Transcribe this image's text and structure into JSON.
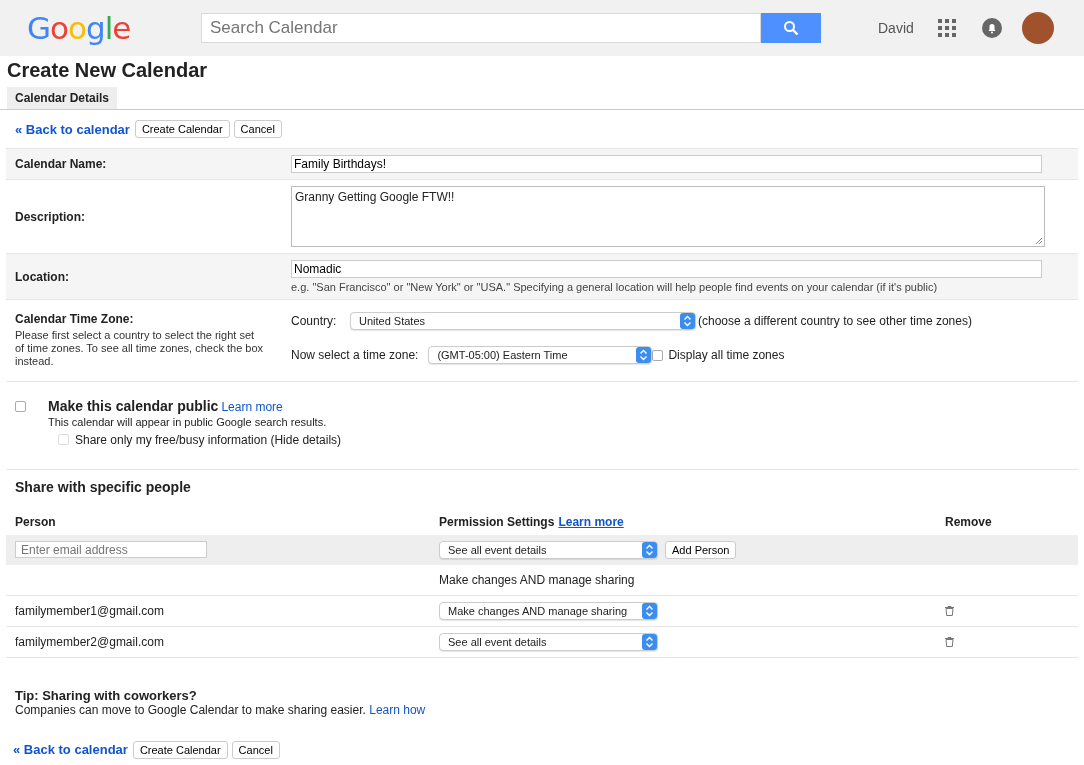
{
  "header": {
    "logo": "Google",
    "search": {
      "placeholder": "Search Calendar"
    },
    "user": "David"
  },
  "title": "Create New Calendar",
  "tabs": [
    {
      "label": "Calendar Details",
      "selected": true
    }
  ],
  "top_actions": {
    "back_link": "« Back to calendar",
    "buttons": [
      "Create Calendar",
      "Cancel"
    ]
  },
  "fields": [
    {
      "kind": "input",
      "label": "Calendar Name:",
      "value": "Family Birthdays!"
    },
    {
      "kind": "textarea",
      "label": "Description:",
      "value": "Granny Getting Google FTW!!"
    },
    {
      "kind": "input",
      "label": "Location:",
      "value": "Nomadic",
      "hint": "e.g. \"San Francisco\" or \"New York\" or \"USA.\" Specifying a general location will help people find events on your calendar (if it's public)"
    }
  ],
  "time_zone": {
    "label": "Calendar Time Zone:",
    "help": "Please first select a country to select the right set of time zones. To see all time zones, check the box instead.",
    "country_label": "Country:",
    "country": "United States",
    "country_note": "(choose a different country to see other time zones)",
    "zone_label": "Now select a time zone:",
    "zone": "(GMT-05:00) Eastern Time",
    "display_all": {
      "label": "Display all time zones",
      "checked": false
    }
  },
  "public": {
    "label": "Make this calendar public",
    "checked": false,
    "learn_more": "Learn more",
    "note": "This calendar will appear in public Google search results.",
    "free_busy": {
      "label": "Share only my free/busy information (Hide details)",
      "checked": false
    }
  },
  "sharing": {
    "title": "Share with specific people",
    "columns": [
      "Person",
      "Permission Settings",
      "Remove"
    ],
    "learn_more": "Learn more",
    "email": {
      "placeholder": "Enter email address"
    },
    "permission": "See all event details",
    "add_button": "Add Person",
    "owner_permission": "Make changes AND manage sharing",
    "people": [
      {
        "email": "familymember1@gmail.com",
        "permission": "Make changes AND manage sharing"
      },
      {
        "email": "familymember2@gmail.com",
        "permission": "See all event details"
      }
    ]
  },
  "tip": {
    "title": "Tip: Sharing with coworkers?",
    "text": "Companies can move to Google Calendar to make sharing easier.",
    "link": "Learn how"
  },
  "bottom_actions": {
    "back_link": "« Back to calendar",
    "buttons": [
      "Create Calendar",
      "Cancel"
    ]
  }
}
